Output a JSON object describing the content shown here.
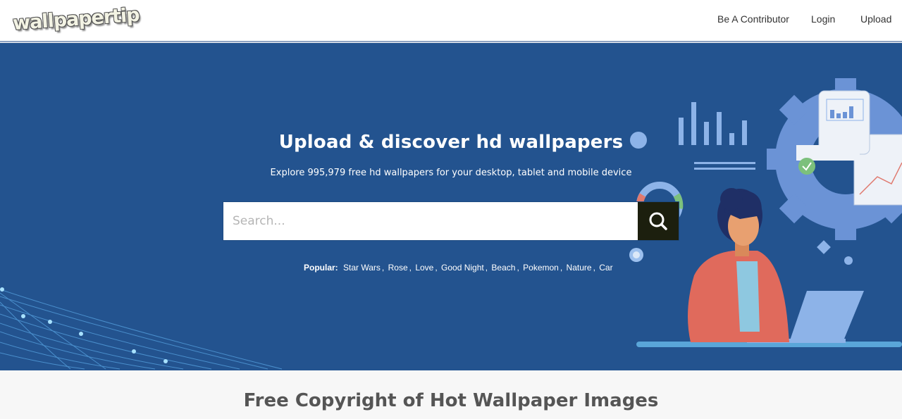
{
  "header": {
    "logo_text": "wallpapertip",
    "nav": [
      {
        "label": "Be A Contributor"
      },
      {
        "label": "Login"
      },
      {
        "label": "Upload"
      }
    ]
  },
  "hero": {
    "title": "Upload & discover hd wallpapers",
    "subtitle": "Explore 995,979 free hd wallpapers for your desktop, tablet and mobile device",
    "search": {
      "value": "",
      "placeholder": "Search...",
      "button_icon": "search-icon"
    },
    "popular": {
      "label": "Popular:",
      "tags": [
        "Star Wars",
        "Rose",
        "Love",
        "Good Night",
        "Beach",
        "Pokemon",
        "Nature",
        "Car"
      ]
    }
  },
  "section": {
    "title": "Free Copyright of Hot Wallpaper Images"
  },
  "colors": {
    "hero_bg": "#23538f",
    "search_button_bg": "#1c1f0e",
    "nav_text": "#333333"
  }
}
